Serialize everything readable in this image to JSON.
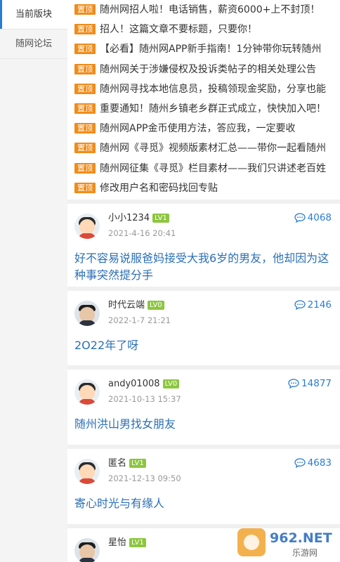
{
  "sidebar": {
    "items": [
      {
        "label": "当前版块"
      },
      {
        "label": "随网论坛"
      }
    ]
  },
  "pinned": {
    "badge": "置顶",
    "items": [
      "随州网招人啦！电话销售，薪资6000+上不封顶！",
      "招人！这篇文章不要标题，只要你！",
      "【必看】随州网APP新手指南！1分钟带你玩转随州",
      "随州网关于涉嫌侵权及投诉类帖子的相关处理公告",
      "随州网寻找本地信息员，投稿领现金奖励，分享也能",
      "重要通知！随州乡镇老乡群正式成立，快快加入吧！",
      "随州网APP金币使用方法，答应我，一定要收",
      "随州网《寻觅》视频版素材汇总——带你一起看随州",
      "随州网征集《寻觅》栏目素材——我们只讲述老百姓",
      "修改用户名和密码找回专贴"
    ]
  },
  "posts": [
    {
      "user": "小小1234",
      "level": "LV1",
      "time": "2021-4-16 20:41",
      "comments": "4068",
      "title": "好不容易说服爸妈接受大我6岁的男友，他却因为这种事突然提分手"
    },
    {
      "user": "时代云端",
      "level": "LV0",
      "time": "2022-1-7 21:21",
      "comments": "2146",
      "title": "2O22年了呀"
    },
    {
      "user": "andy01008",
      "level": "LV0",
      "time": "2021-10-13 15:37",
      "comments": "14877",
      "title": "随州洪山男找女朋友"
    },
    {
      "user": "匿名",
      "level": "LV1",
      "time": "2021-12-13 09:50",
      "comments": "4683",
      "title": "寄心时光与有缘人"
    },
    {
      "user": "星怡",
      "level": "LV1",
      "time": "",
      "comments": "",
      "title": ""
    }
  ],
  "watermark": {
    "brand": "962.NET",
    "sub": "乐游网"
  },
  "colors": {
    "accent": "#2a7bd4",
    "badge": "#f08c1a",
    "level": "#8cc63f",
    "title": "#2b6fb6"
  }
}
